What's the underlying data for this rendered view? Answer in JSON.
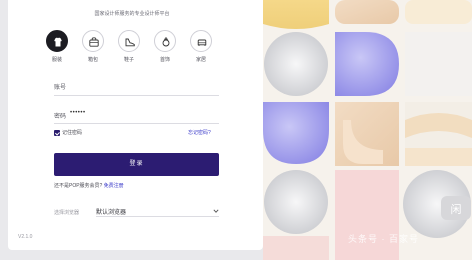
{
  "subtitle": "国家设计师服务的专业设计师平台",
  "categories": [
    {
      "label": "服装",
      "icon": "apparel-icon",
      "active": true
    },
    {
      "label": "箱包",
      "icon": "bag-icon",
      "active": false
    },
    {
      "label": "鞋子",
      "icon": "shoe-icon",
      "active": false
    },
    {
      "label": "首饰",
      "icon": "jewelry-icon",
      "active": false
    },
    {
      "label": "家居",
      "icon": "sofa-icon",
      "active": false
    }
  ],
  "form": {
    "account_label": "账号",
    "password_label": "密码",
    "password_value": "••••••",
    "remember_label": "记住密码",
    "forgot_label": "忘记密码?",
    "login_label": "登录",
    "register_question": "还不是POP服务会员?",
    "register_link": "免费注册",
    "browser_label": "选择浏览器",
    "browser_value": "默认浏览器"
  },
  "version": "V2.1.0",
  "watermark": "头条号 · 百家号",
  "colors": {
    "primary": "#2c1c72",
    "link": "#3a3ac9"
  }
}
